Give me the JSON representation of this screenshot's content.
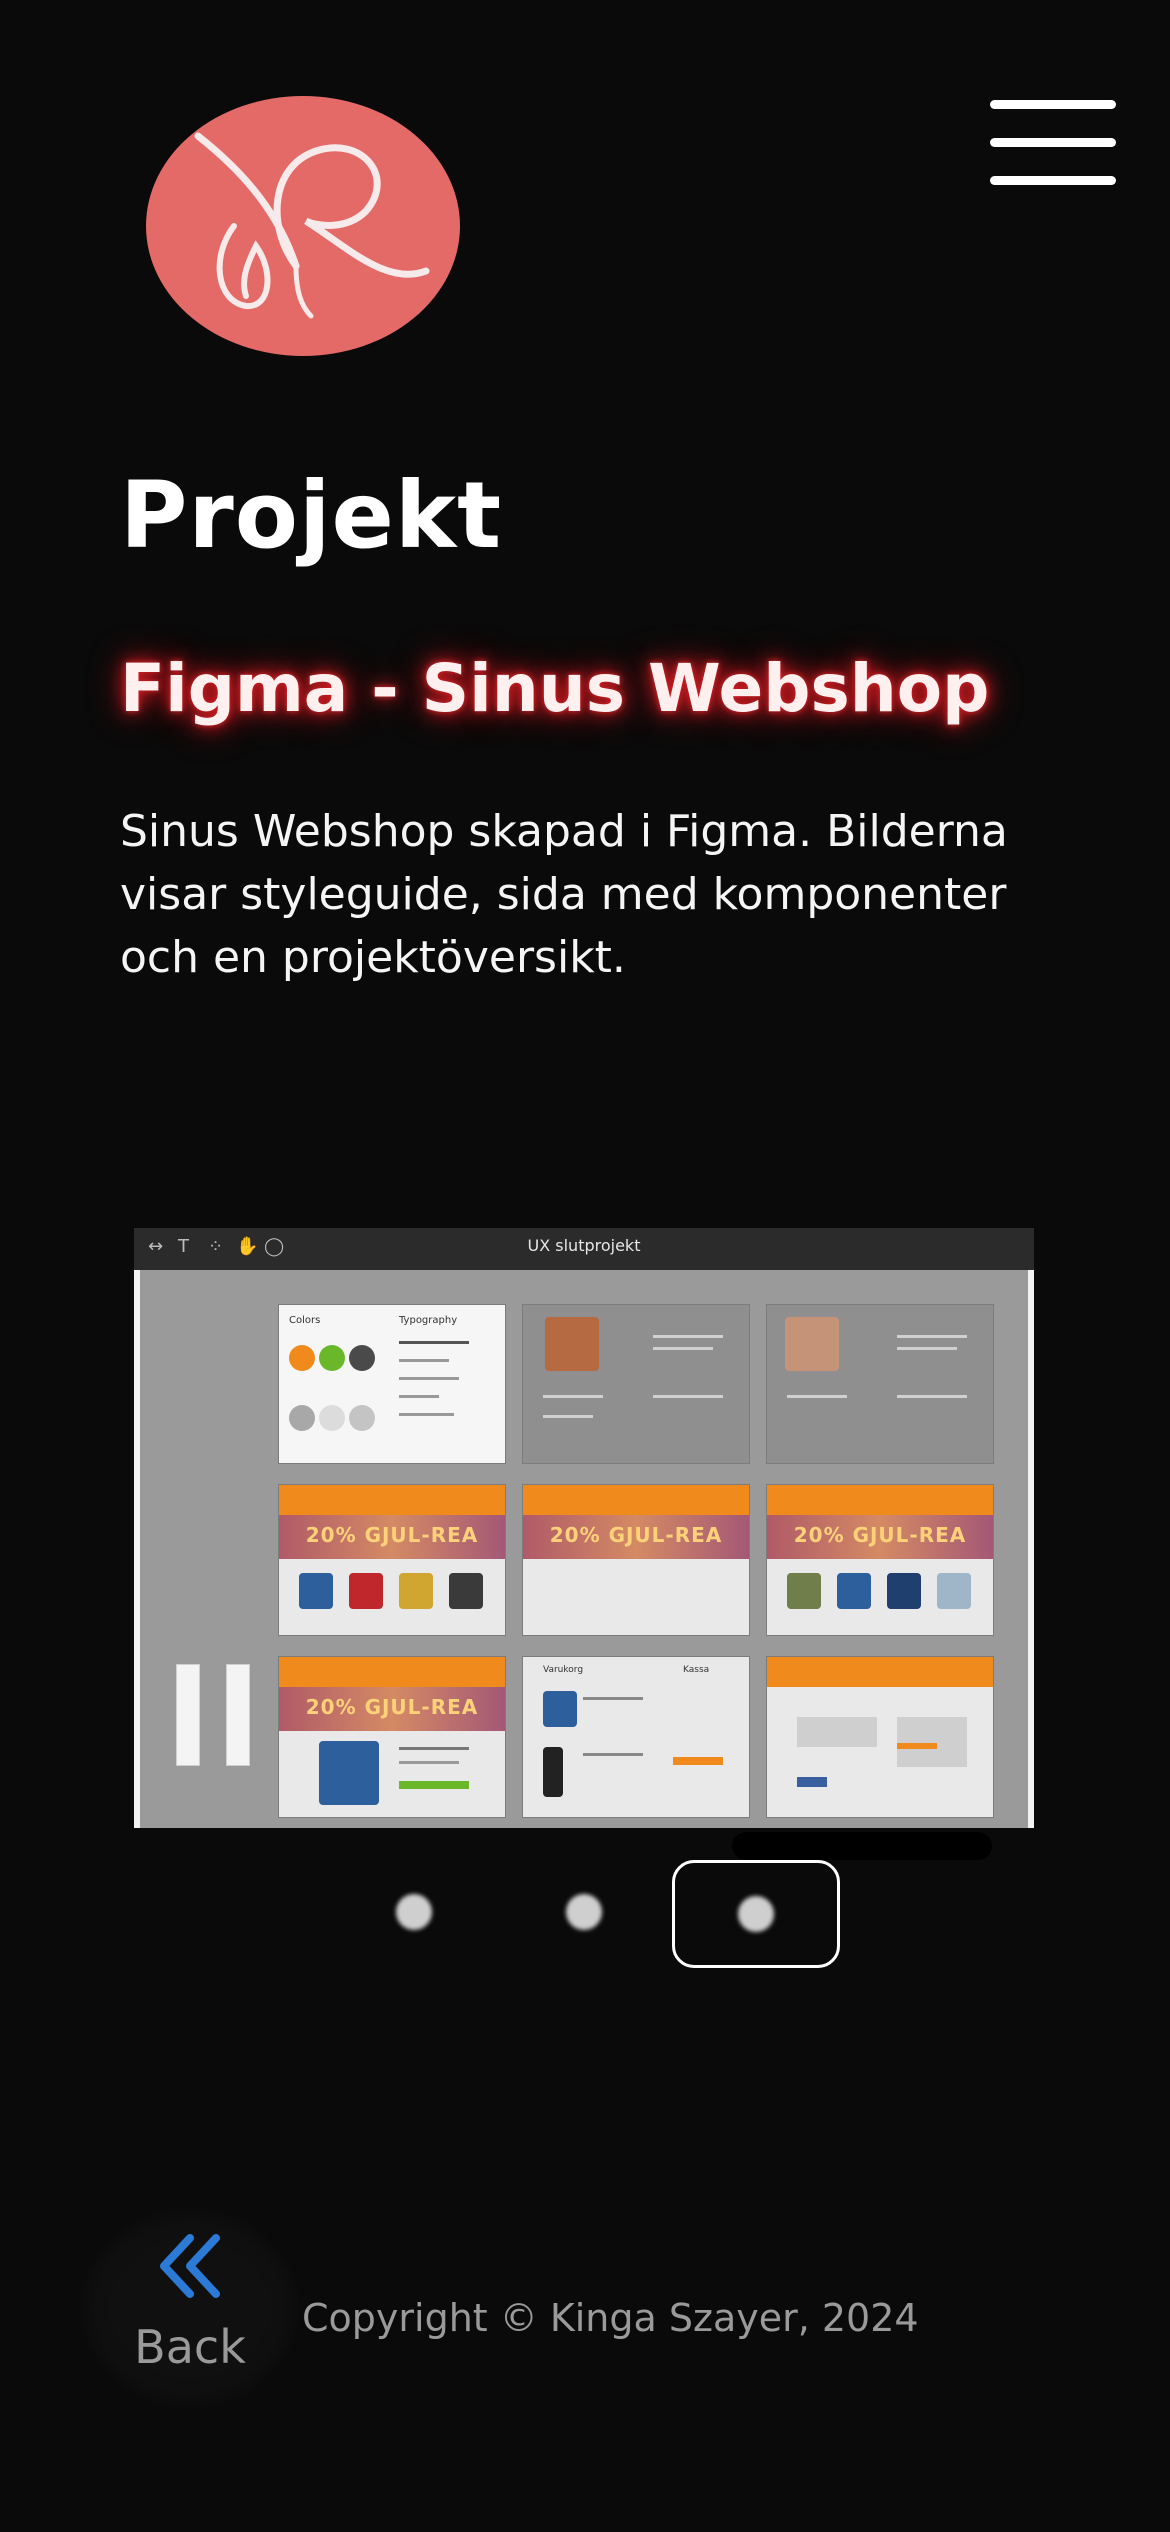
{
  "header": {
    "logo_icon": "kinga-logo-icon",
    "menu_icon": "hamburger-menu-icon"
  },
  "page": {
    "title": "Projekt"
  },
  "project": {
    "title": "Figma - Sinus Webshop",
    "description": "Sinus Webshop skapad i Figma. Bilderna visar styleguide, sida med komponenter och en projektöversikt."
  },
  "carousel": {
    "toolbar_title": "UX slutprojekt",
    "sale_banner": "20% GJUL-REA",
    "dots": [
      "slide-1",
      "slide-2",
      "slide-3"
    ],
    "active_index": 2
  },
  "figma_frames": {
    "colors_label": "Colors",
    "typography_label": "Typography",
    "cart_left": "Varukorg",
    "cart_right": "Kassa"
  },
  "footer": {
    "back_label": "Back",
    "copyright": "Copyright © Kinga Szayer, 2024"
  },
  "colors": {
    "background": "#0a0a0a",
    "logo": "#e46a67",
    "title_glow": "#d41c22",
    "back_chevron": "#2b7bd6"
  }
}
